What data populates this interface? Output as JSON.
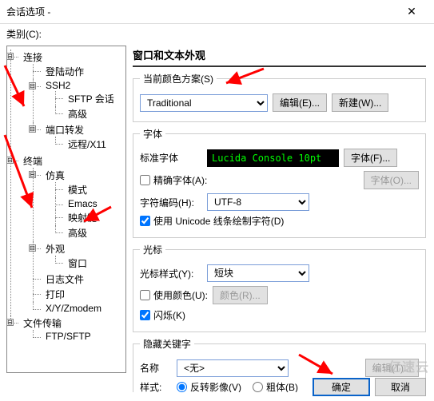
{
  "window": {
    "title": "会话选项 -",
    "close_glyph": "✕"
  },
  "category_label": "类别(C):",
  "tree": {
    "items": [
      {
        "label": "连接",
        "children": [
          {
            "label": "登陆动作"
          },
          {
            "label": "SSH2",
            "children": [
              {
                "label": "SFTP 会话"
              },
              {
                "label": "高级"
              }
            ]
          },
          {
            "label": "端口转发",
            "children": [
              {
                "label": "远程/X11"
              }
            ]
          }
        ]
      },
      {
        "label": "终端",
        "children": [
          {
            "label": "仿真",
            "children": [
              {
                "label": "模式"
              },
              {
                "label": "Emacs"
              },
              {
                "label": "映射键"
              },
              {
                "label": "高级"
              }
            ]
          },
          {
            "label": "外观",
            "children": [
              {
                "label": "窗口"
              }
            ]
          },
          {
            "label": "日志文件"
          },
          {
            "label": "打印"
          },
          {
            "label": "X/Y/Zmodem"
          }
        ]
      },
      {
        "label": "文件传输",
        "children": [
          {
            "label": "FTP/SFTP"
          }
        ]
      }
    ]
  },
  "panel_title": "窗口和文本外观",
  "scheme": {
    "group_label": "当前颜色方案(S)",
    "value": "Traditional",
    "edit_btn": "编辑(E)...",
    "new_btn": "新建(W)..."
  },
  "font": {
    "group_label": "字体",
    "standard_label": "标准字体",
    "preview_text": "Lucida Console 10pt",
    "font_btn": "字体(F)...",
    "exact_chk_label": "精确字体(A):",
    "exact_chk_checked": false,
    "font_o_btn": "字体(O)...",
    "encoding_label": "字符编码(H):",
    "encoding_value": "UTF-8",
    "unicode_chk_label": "使用 Unicode 线条绘制字符(D)",
    "unicode_chk_checked": true
  },
  "cursor": {
    "group_label": "光标",
    "style_label": "光标样式(Y):",
    "style_value": "短块",
    "use_color_chk": "使用颜色(U):",
    "use_color_checked": false,
    "color_btn": "颜色(R)...",
    "blink_chk": "闪烁(K)",
    "blink_checked": true
  },
  "hidden": {
    "group_label": "隐藏关键字",
    "name_label": "名称",
    "name_value": "<无>",
    "edit_btn": "编辑(T)...",
    "style_label": "样式:",
    "radio_reverse": "反转影像(V)",
    "radio_bold": "粗体(B)",
    "radio_selected": "reverse"
  },
  "footer": {
    "ok": "确定",
    "cancel": "取消"
  },
  "watermark": "亿速云",
  "toggle_glyph": "⊟"
}
